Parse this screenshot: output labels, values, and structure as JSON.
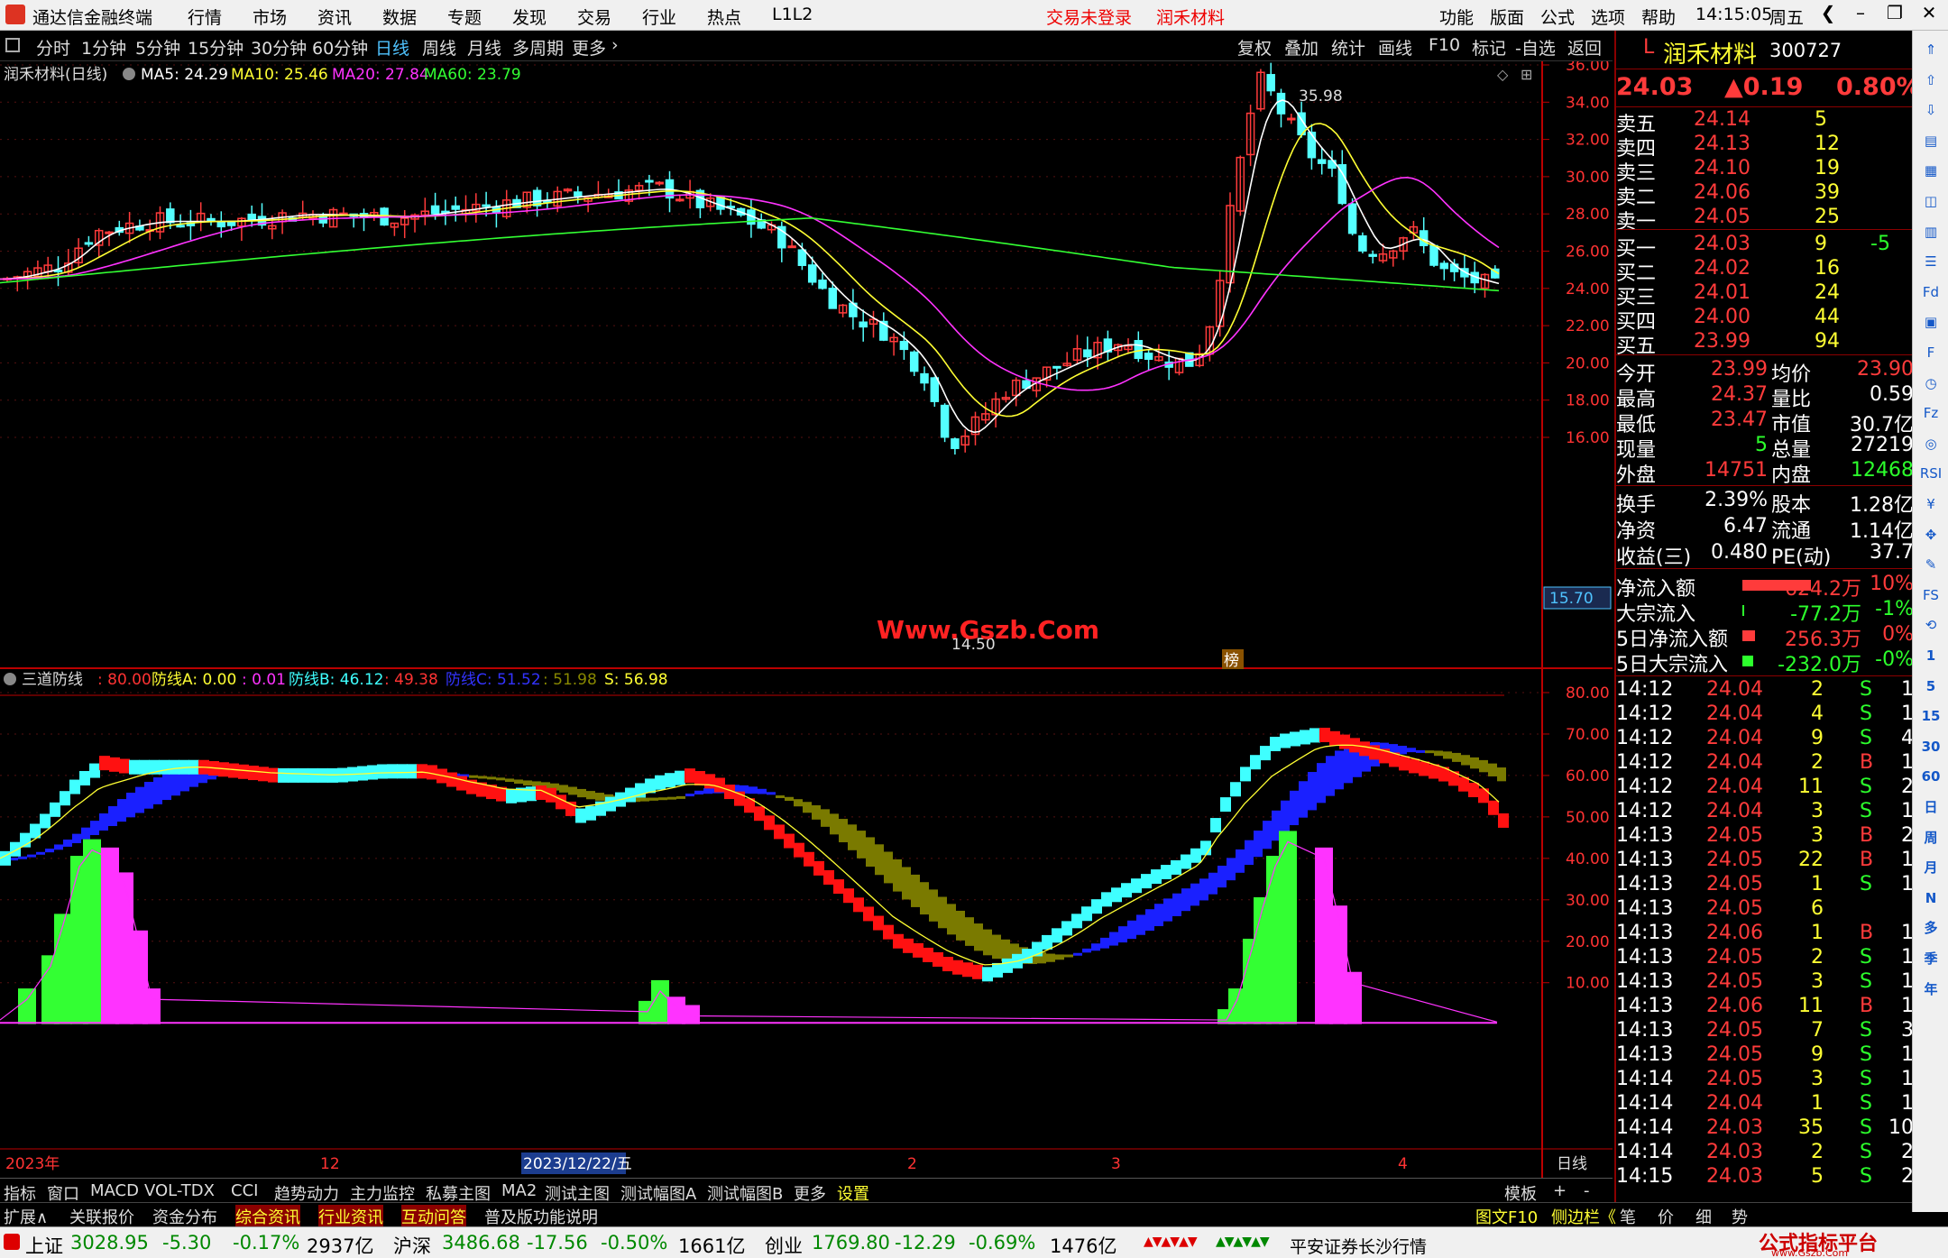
{
  "menubar": {
    "app_title": "通达信金融终端",
    "items": [
      "行情",
      "市场",
      "资讯",
      "数据",
      "专题",
      "发现",
      "交易",
      "行业",
      "热点",
      "L1L2"
    ],
    "login": "交易未登录",
    "stock_name": "润禾材料",
    "right_items": [
      "功能",
      "版面",
      "公式",
      "选项",
      "帮助"
    ],
    "time": "14:15:05",
    "weekday": "周五"
  },
  "toolbar": {
    "periods": [
      "分时",
      "1分钟",
      "5分钟",
      "15分钟",
      "30分钟",
      "60分钟",
      "日线",
      "周线",
      "月线",
      "多周期",
      "更多"
    ],
    "active": "日线",
    "right_items": [
      "复权",
      "叠加",
      "统计",
      "画线",
      "F10",
      "标记",
      "-自选",
      "返回"
    ]
  },
  "main_chart": {
    "title": "润禾材料(日线)",
    "ma5": "MA5: 24.29",
    "ma10": "MA10: 25.46",
    "ma20": "MA20: 27.84",
    "ma60": "MA60: 23.79",
    "high_label": "35.98",
    "low_label": "14.50",
    "watermark": "Www.Gszb.Com",
    "price_tag": "15.70",
    "bang": "榜",
    "yticks": [
      "36.00",
      "34.00",
      "32.00",
      "30.00",
      "28.00",
      "26.00",
      "24.00",
      "22.00",
      "20.00",
      "18.00",
      "16.00"
    ]
  },
  "indicator": {
    "name": "三道防线",
    "v1": ": 80.00",
    "a_label": "防线A: 0.00",
    "v2": ": 0.01",
    "b_label": "防线B: 46.12",
    "v3": ": 49.38",
    "c_label": "防线C: 51.52",
    "v4": ": 51.98",
    "s_label": "S: 56.98",
    "yticks": [
      "80.00",
      "70.00",
      "60.00",
      "50.00",
      "40.00",
      "30.00",
      "20.00",
      "10.00"
    ]
  },
  "xaxis": {
    "labels": [
      "2023年",
      "12",
      "2023/12/22/五",
      "2",
      "3",
      "4"
    ],
    "period": "日线"
  },
  "quote": {
    "code_prefix": "L",
    "name": "润禾材料",
    "code": "300727",
    "price": "24.03",
    "change": "▲0.19",
    "pct": "0.80%",
    "asks": [
      {
        "l": "卖五",
        "p": "24.14",
        "v": "5"
      },
      {
        "l": "卖四",
        "p": "24.13",
        "v": "12"
      },
      {
        "l": "卖三",
        "p": "24.10",
        "v": "19"
      },
      {
        "l": "卖二",
        "p": "24.06",
        "v": "39"
      },
      {
        "l": "卖一",
        "p": "24.05",
        "v": "25"
      }
    ],
    "bids": [
      {
        "l": "买一",
        "p": "24.03",
        "v": "9",
        "d": "-5"
      },
      {
        "l": "买二",
        "p": "24.02",
        "v": "16",
        "d": ""
      },
      {
        "l": "买三",
        "p": "24.01",
        "v": "24",
        "d": ""
      },
      {
        "l": "买四",
        "p": "24.00",
        "v": "44",
        "d": ""
      },
      {
        "l": "买五",
        "p": "23.99",
        "v": "94",
        "d": ""
      }
    ],
    "stats": [
      {
        "a": "今开",
        "b": "23.99",
        "c": "均价",
        "d": "23.90"
      },
      {
        "a": "最高",
        "b": "24.37",
        "c": "量比",
        "d": "0.59"
      },
      {
        "a": "最低",
        "b": "23.47",
        "c": "市值",
        "d": "30.7亿"
      },
      {
        "a": "现量",
        "b": "5",
        "c": "总量",
        "d": "27219"
      },
      {
        "a": "外盘",
        "b": "14751",
        "c": "内盘",
        "d": "12468"
      }
    ],
    "stats2": [
      {
        "a": "换手",
        "b": "2.39%",
        "c": "股本",
        "d": "1.28亿"
      },
      {
        "a": "净资",
        "b": "6.47",
        "c": "流通",
        "d": "1.14亿"
      },
      {
        "a": "收益(三)",
        "b": "0.480",
        "c": "PE(动)",
        "d": "37.7"
      }
    ],
    "flows": [
      {
        "a": "净流入额",
        "v": "624.2万",
        "p": "10%"
      },
      {
        "a": "大宗流入",
        "v": "-77.2万",
        "p": "-1%"
      },
      {
        "a": "5日净流入额",
        "v": "256.3万",
        "p": "0%"
      },
      {
        "a": "5日大宗流入",
        "v": "-232.0万",
        "p": "-0%"
      }
    ],
    "ticks": [
      [
        "14:12",
        "24.04",
        "2",
        "S",
        "1"
      ],
      [
        "14:12",
        "24.04",
        "4",
        "S",
        "1"
      ],
      [
        "14:12",
        "24.04",
        "9",
        "S",
        "4"
      ],
      [
        "14:12",
        "24.04",
        "2",
        "B",
        "1"
      ],
      [
        "14:12",
        "24.04",
        "11",
        "S",
        "2"
      ],
      [
        "14:12",
        "24.04",
        "3",
        "S",
        "1"
      ],
      [
        "14:13",
        "24.05",
        "3",
        "B",
        "2"
      ],
      [
        "14:13",
        "24.05",
        "22",
        "B",
        "1"
      ],
      [
        "14:13",
        "24.05",
        "1",
        "S",
        "1"
      ],
      [
        "14:13",
        "24.05",
        "6",
        "",
        ""
      ],
      [
        "14:13",
        "24.06",
        "1",
        "B",
        "1"
      ],
      [
        "14:13",
        "24.05",
        "2",
        "S",
        "1"
      ],
      [
        "14:13",
        "24.05",
        "3",
        "S",
        "1"
      ],
      [
        "14:13",
        "24.06",
        "11",
        "B",
        "1"
      ],
      [
        "14:13",
        "24.05",
        "7",
        "S",
        "3"
      ],
      [
        "14:13",
        "24.05",
        "9",
        "S",
        "1"
      ],
      [
        "14:14",
        "24.05",
        "3",
        "S",
        "1"
      ],
      [
        "14:14",
        "24.04",
        "1",
        "S",
        "1"
      ],
      [
        "14:14",
        "24.03",
        "35",
        "S",
        "10"
      ],
      [
        "14:14",
        "24.03",
        "2",
        "S",
        "2"
      ],
      [
        "14:15",
        "24.03",
        "5",
        "S",
        "2"
      ]
    ]
  },
  "tabs1": [
    "指标",
    "窗口",
    "MACD",
    "VOL-TDX",
    "CCI",
    "趋势动力",
    "主力监控",
    "私募主图",
    "MA2",
    "测试主图",
    "测试幅图A",
    "测试幅图B",
    "更多",
    "设置"
  ],
  "tabs1_right": [
    "模板",
    "+",
    "-"
  ],
  "tabs2": [
    "扩展∧",
    "关联报价",
    "资金分布",
    "综合资讯",
    "行业资讯",
    "互动问答",
    "普及版功能说明"
  ],
  "tabs2_right": [
    "图文F10",
    "侧边栏《",
    "笔",
    "价",
    "细",
    "势"
  ],
  "status": {
    "sh_name": "上证",
    "sh_val": "3028.95",
    "sh_chg": "-5.30",
    "sh_pct": "-0.17%",
    "sh_amt": "2937亿",
    "sz_name": "沪深",
    "sz_val": "3486.68",
    "sz_chg": "-17.56",
    "sz_pct": "-0.50%",
    "sz_amt": "1661亿",
    "cy_name": "创业",
    "cy_val": "1769.80",
    "cy_chg": "-12.29",
    "cy_pct": "-0.69%",
    "cy_amt": "1476亿",
    "broker": "平安证券长沙行情",
    "brand": "公式指标平台",
    "brand_url": "www.Gszb.Com"
  },
  "side_icons": [
    "up-icon",
    "up-arrow-icon",
    "down-arrow-icon",
    "news-icon",
    "f10-icon",
    "chart-icon",
    "volume-icon",
    "list-icon",
    "fund-icon",
    "grid-icon",
    "f-icon",
    "clock-icon",
    "f2-icon",
    "compass-icon",
    "rsi-icon",
    "coin-icon",
    "move-icon",
    "pen-icon",
    "fs-icon",
    "sync-icon",
    "1",
    "5",
    "15",
    "30",
    "60",
    "日",
    "周",
    "月",
    "N",
    "多",
    "季",
    "年"
  ]
}
